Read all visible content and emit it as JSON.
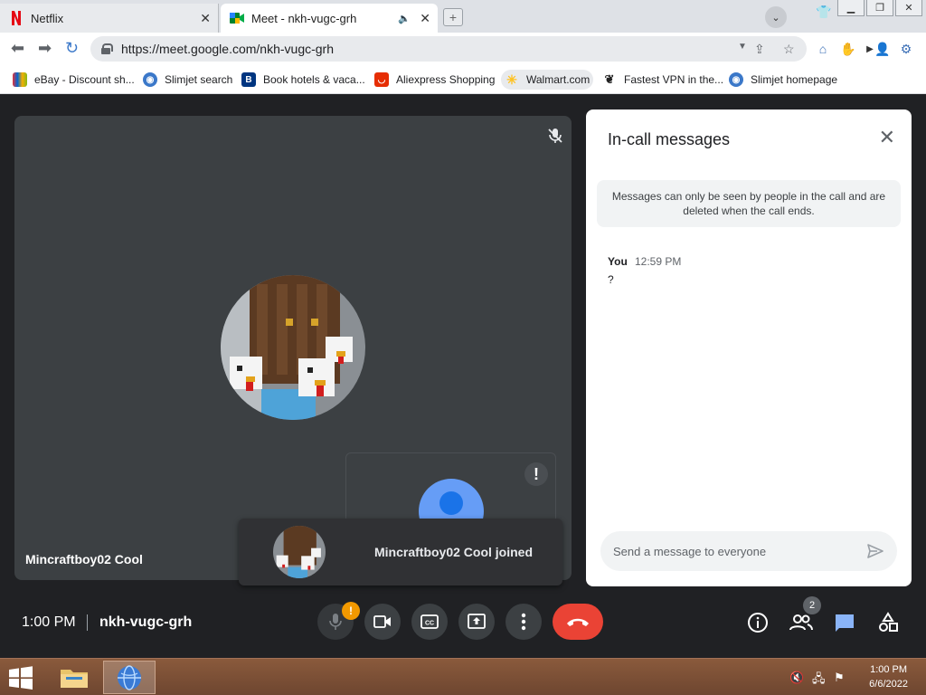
{
  "browser": {
    "tabs": [
      {
        "title": "Netflix",
        "active": false
      },
      {
        "title": "Meet - nkh-vugc-grh",
        "active": true
      }
    ],
    "url": "https://meet.google.com/nkh-vugc-grh",
    "bookmarks": [
      {
        "label": "eBay - Discount sh...",
        "icon": "ebay-icon"
      },
      {
        "label": "Slimjet search",
        "icon": "globe-icon"
      },
      {
        "label": "Book hotels & vaca...",
        "icon": "booking-icon"
      },
      {
        "label": "Aliexpress Shopping",
        "icon": "aliexpress-icon"
      },
      {
        "label": "Walmart.com",
        "icon": "walmart-icon"
      },
      {
        "label": "Fastest VPN in the...",
        "icon": "vpn-icon"
      },
      {
        "label": "Slimjet homepage",
        "icon": "globe-icon"
      }
    ]
  },
  "meeting": {
    "participant_name": "Mincraftboy02 Cool",
    "toast": "Mincraftboy02 Cool joined",
    "self_alert": "!",
    "time": "1:00 PM",
    "code": "nkh-vugc-grh",
    "mic_badge": "!",
    "people_count": "2"
  },
  "chat": {
    "title": "In-call messages",
    "notice": "Messages can only be seen by people in the call and are deleted when the call ends.",
    "messages": [
      {
        "sender": "You",
        "time": "12:59 PM",
        "text": "?"
      }
    ],
    "input_placeholder": "Send a message to everyone"
  },
  "taskbar": {
    "clock_time": "1:00 PM",
    "clock_date": "6/6/2022"
  },
  "colors": {
    "meet_bg": "#202124",
    "tile_bg": "#3c4043",
    "end_call": "#ea4335",
    "chat_icon_active": "#8ab4f8",
    "mic_warning": "#f29900",
    "netflix_red": "#e50914"
  }
}
